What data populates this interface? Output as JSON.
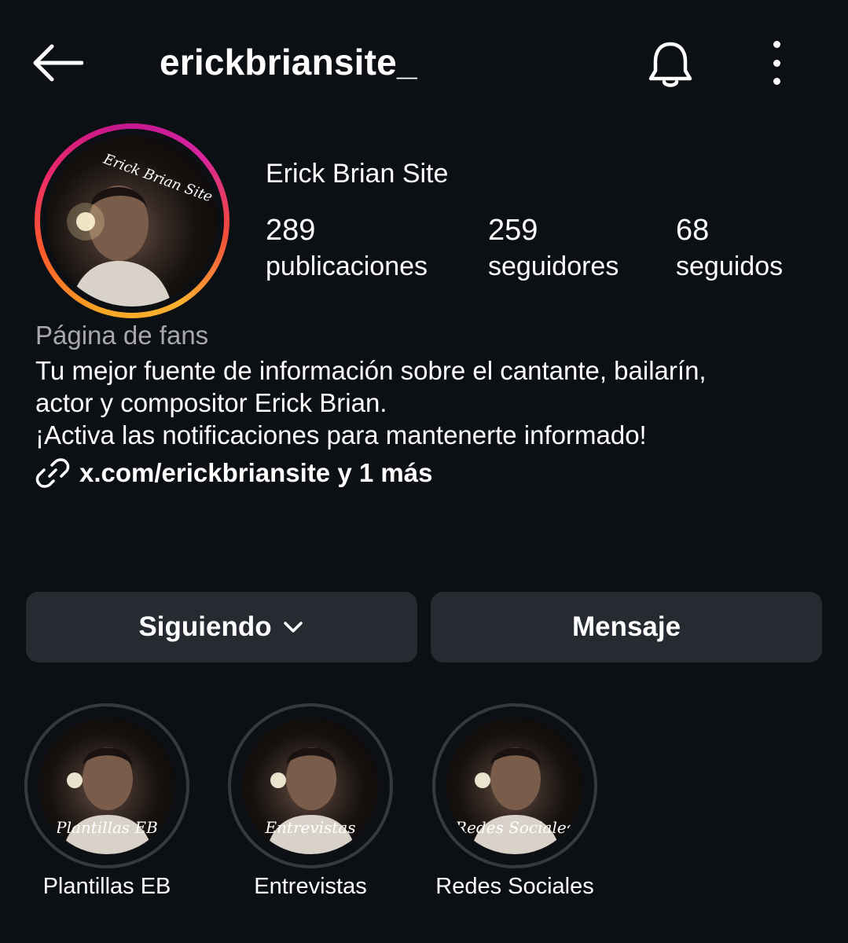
{
  "header": {
    "username": "erickbriansite_",
    "back_icon": "arrow-left-icon",
    "bell_icon": "bell-icon",
    "more_icon": "more-vertical-icon"
  },
  "profile": {
    "avatar_text": "Erick Brian Site",
    "display_name": "Erick Brian Site",
    "stats": [
      {
        "value": "289",
        "label": "publicaciones"
      },
      {
        "value": "259",
        "label": "seguidores"
      },
      {
        "value": "68",
        "label": "seguidos"
      }
    ],
    "category": "Página de fans",
    "bio": [
      "Tu mejor fuente de información sobre el cantante, bailarín,",
      "actor y compositor Erick Brian.",
      "¡Activa las notificaciones para mantenerte informado!"
    ],
    "link": "x.com/erickbriansite y 1 más",
    "link_icon": "link-icon"
  },
  "actions": {
    "following_label": "Siguiendo",
    "message_label": "Mensaje"
  },
  "highlights": [
    {
      "label": "Plantillas EB",
      "cover_text": "Plantillas EB"
    },
    {
      "label": "Entrevistas",
      "cover_text": "Entrevistas"
    },
    {
      "label": "Redes Sociales",
      "cover_text": "Redes Sociales"
    }
  ],
  "colors": {
    "background": "#0c0f14",
    "button": "#262a31",
    "muted_text": "#a8a8a8"
  }
}
